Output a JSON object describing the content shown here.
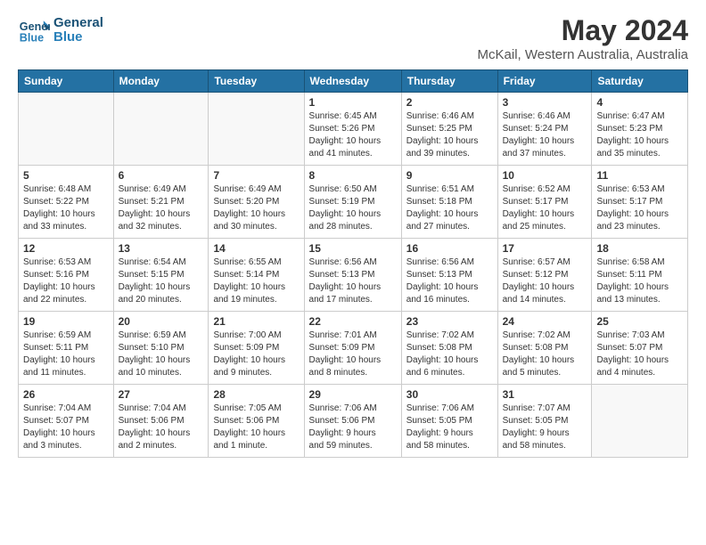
{
  "header": {
    "logo_line1": "General",
    "logo_line2": "Blue",
    "month_title": "May 2024",
    "location": "McKail, Western Australia, Australia"
  },
  "days_of_week": [
    "Sunday",
    "Monday",
    "Tuesday",
    "Wednesday",
    "Thursday",
    "Friday",
    "Saturday"
  ],
  "weeks": [
    [
      {
        "day": "",
        "info": ""
      },
      {
        "day": "",
        "info": ""
      },
      {
        "day": "",
        "info": ""
      },
      {
        "day": "1",
        "info": "Sunrise: 6:45 AM\nSunset: 5:26 PM\nDaylight: 10 hours\nand 41 minutes."
      },
      {
        "day": "2",
        "info": "Sunrise: 6:46 AM\nSunset: 5:25 PM\nDaylight: 10 hours\nand 39 minutes."
      },
      {
        "day": "3",
        "info": "Sunrise: 6:46 AM\nSunset: 5:24 PM\nDaylight: 10 hours\nand 37 minutes."
      },
      {
        "day": "4",
        "info": "Sunrise: 6:47 AM\nSunset: 5:23 PM\nDaylight: 10 hours\nand 35 minutes."
      }
    ],
    [
      {
        "day": "5",
        "info": "Sunrise: 6:48 AM\nSunset: 5:22 PM\nDaylight: 10 hours\nand 33 minutes."
      },
      {
        "day": "6",
        "info": "Sunrise: 6:49 AM\nSunset: 5:21 PM\nDaylight: 10 hours\nand 32 minutes."
      },
      {
        "day": "7",
        "info": "Sunrise: 6:49 AM\nSunset: 5:20 PM\nDaylight: 10 hours\nand 30 minutes."
      },
      {
        "day": "8",
        "info": "Sunrise: 6:50 AM\nSunset: 5:19 PM\nDaylight: 10 hours\nand 28 minutes."
      },
      {
        "day": "9",
        "info": "Sunrise: 6:51 AM\nSunset: 5:18 PM\nDaylight: 10 hours\nand 27 minutes."
      },
      {
        "day": "10",
        "info": "Sunrise: 6:52 AM\nSunset: 5:17 PM\nDaylight: 10 hours\nand 25 minutes."
      },
      {
        "day": "11",
        "info": "Sunrise: 6:53 AM\nSunset: 5:17 PM\nDaylight: 10 hours\nand 23 minutes."
      }
    ],
    [
      {
        "day": "12",
        "info": "Sunrise: 6:53 AM\nSunset: 5:16 PM\nDaylight: 10 hours\nand 22 minutes."
      },
      {
        "day": "13",
        "info": "Sunrise: 6:54 AM\nSunset: 5:15 PM\nDaylight: 10 hours\nand 20 minutes."
      },
      {
        "day": "14",
        "info": "Sunrise: 6:55 AM\nSunset: 5:14 PM\nDaylight: 10 hours\nand 19 minutes."
      },
      {
        "day": "15",
        "info": "Sunrise: 6:56 AM\nSunset: 5:13 PM\nDaylight: 10 hours\nand 17 minutes."
      },
      {
        "day": "16",
        "info": "Sunrise: 6:56 AM\nSunset: 5:13 PM\nDaylight: 10 hours\nand 16 minutes."
      },
      {
        "day": "17",
        "info": "Sunrise: 6:57 AM\nSunset: 5:12 PM\nDaylight: 10 hours\nand 14 minutes."
      },
      {
        "day": "18",
        "info": "Sunrise: 6:58 AM\nSunset: 5:11 PM\nDaylight: 10 hours\nand 13 minutes."
      }
    ],
    [
      {
        "day": "19",
        "info": "Sunrise: 6:59 AM\nSunset: 5:11 PM\nDaylight: 10 hours\nand 11 minutes."
      },
      {
        "day": "20",
        "info": "Sunrise: 6:59 AM\nSunset: 5:10 PM\nDaylight: 10 hours\nand 10 minutes."
      },
      {
        "day": "21",
        "info": "Sunrise: 7:00 AM\nSunset: 5:09 PM\nDaylight: 10 hours\nand 9 minutes."
      },
      {
        "day": "22",
        "info": "Sunrise: 7:01 AM\nSunset: 5:09 PM\nDaylight: 10 hours\nand 8 minutes."
      },
      {
        "day": "23",
        "info": "Sunrise: 7:02 AM\nSunset: 5:08 PM\nDaylight: 10 hours\nand 6 minutes."
      },
      {
        "day": "24",
        "info": "Sunrise: 7:02 AM\nSunset: 5:08 PM\nDaylight: 10 hours\nand 5 minutes."
      },
      {
        "day": "25",
        "info": "Sunrise: 7:03 AM\nSunset: 5:07 PM\nDaylight: 10 hours\nand 4 minutes."
      }
    ],
    [
      {
        "day": "26",
        "info": "Sunrise: 7:04 AM\nSunset: 5:07 PM\nDaylight: 10 hours\nand 3 minutes."
      },
      {
        "day": "27",
        "info": "Sunrise: 7:04 AM\nSunset: 5:06 PM\nDaylight: 10 hours\nand 2 minutes."
      },
      {
        "day": "28",
        "info": "Sunrise: 7:05 AM\nSunset: 5:06 PM\nDaylight: 10 hours\nand 1 minute."
      },
      {
        "day": "29",
        "info": "Sunrise: 7:06 AM\nSunset: 5:06 PM\nDaylight: 9 hours\nand 59 minutes."
      },
      {
        "day": "30",
        "info": "Sunrise: 7:06 AM\nSunset: 5:05 PM\nDaylight: 9 hours\nand 58 minutes."
      },
      {
        "day": "31",
        "info": "Sunrise: 7:07 AM\nSunset: 5:05 PM\nDaylight: 9 hours\nand 58 minutes."
      },
      {
        "day": "",
        "info": ""
      }
    ]
  ]
}
